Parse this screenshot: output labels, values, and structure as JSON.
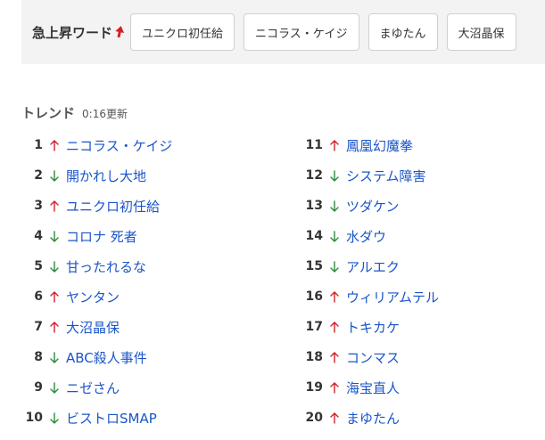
{
  "rising": {
    "label": "急上昇ワード",
    "arrow_icon": "red-up-arrow-icon",
    "chips": [
      "ユニクロ初任給",
      "ニコラス・ケイジ",
      "まゆたん",
      "大沼晶保"
    ]
  },
  "trends": {
    "title": "トレンド",
    "updated": "0:16更新",
    "colors": {
      "up": "#d0202a",
      "down": "#2a8c3a",
      "link": "#1a55c9"
    },
    "items": [
      {
        "rank": "1",
        "dir": "up",
        "word": "ニコラス・ケイジ"
      },
      {
        "rank": "2",
        "dir": "down",
        "word": "開かれし大地"
      },
      {
        "rank": "3",
        "dir": "up",
        "word": "ユニクロ初任給"
      },
      {
        "rank": "4",
        "dir": "down",
        "word": "コロナ 死者"
      },
      {
        "rank": "5",
        "dir": "down",
        "word": "甘ったれるな"
      },
      {
        "rank": "6",
        "dir": "up",
        "word": "ヤンタン"
      },
      {
        "rank": "7",
        "dir": "up",
        "word": "大沼晶保"
      },
      {
        "rank": "8",
        "dir": "down",
        "word": "ABC殺人事件"
      },
      {
        "rank": "9",
        "dir": "down",
        "word": "ニゼさん"
      },
      {
        "rank": "10",
        "dir": "down",
        "word": "ビストロSMAP"
      },
      {
        "rank": "11",
        "dir": "up",
        "word": "鳳凰幻魔拳"
      },
      {
        "rank": "12",
        "dir": "down",
        "word": "システム障害"
      },
      {
        "rank": "13",
        "dir": "down",
        "word": "ツダケン"
      },
      {
        "rank": "14",
        "dir": "down",
        "word": "水ダウ"
      },
      {
        "rank": "15",
        "dir": "down",
        "word": "アルエク"
      },
      {
        "rank": "16",
        "dir": "up",
        "word": "ウィリアムテル"
      },
      {
        "rank": "17",
        "dir": "up",
        "word": "トキカケ"
      },
      {
        "rank": "18",
        "dir": "up",
        "word": "コンマス"
      },
      {
        "rank": "19",
        "dir": "up",
        "word": "海宝直人"
      },
      {
        "rank": "20",
        "dir": "up",
        "word": "まゆたん"
      }
    ]
  }
}
